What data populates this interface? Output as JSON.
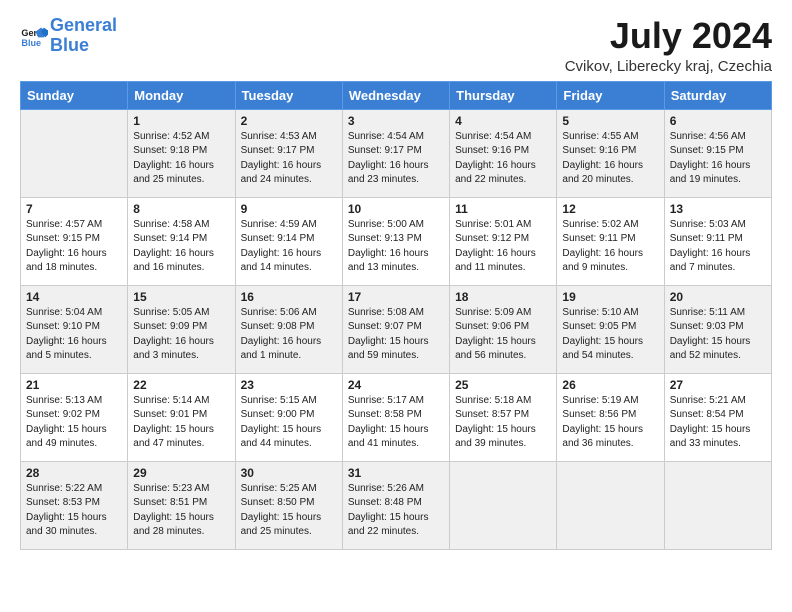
{
  "header": {
    "logo_line1": "General",
    "logo_line2": "Blue",
    "title": "July 2024",
    "subtitle": "Cvikov, Liberecky kraj, Czechia"
  },
  "days_of_week": [
    "Sunday",
    "Monday",
    "Tuesday",
    "Wednesday",
    "Thursday",
    "Friday",
    "Saturday"
  ],
  "weeks": [
    [
      {
        "day": "",
        "sunrise": "",
        "sunset": "",
        "daylight": ""
      },
      {
        "day": "1",
        "sunrise": "Sunrise: 4:52 AM",
        "sunset": "Sunset: 9:18 PM",
        "daylight": "Daylight: 16 hours and 25 minutes."
      },
      {
        "day": "2",
        "sunrise": "Sunrise: 4:53 AM",
        "sunset": "Sunset: 9:17 PM",
        "daylight": "Daylight: 16 hours and 24 minutes."
      },
      {
        "day": "3",
        "sunrise": "Sunrise: 4:54 AM",
        "sunset": "Sunset: 9:17 PM",
        "daylight": "Daylight: 16 hours and 23 minutes."
      },
      {
        "day": "4",
        "sunrise": "Sunrise: 4:54 AM",
        "sunset": "Sunset: 9:16 PM",
        "daylight": "Daylight: 16 hours and 22 minutes."
      },
      {
        "day": "5",
        "sunrise": "Sunrise: 4:55 AM",
        "sunset": "Sunset: 9:16 PM",
        "daylight": "Daylight: 16 hours and 20 minutes."
      },
      {
        "day": "6",
        "sunrise": "Sunrise: 4:56 AM",
        "sunset": "Sunset: 9:15 PM",
        "daylight": "Daylight: 16 hours and 19 minutes."
      }
    ],
    [
      {
        "day": "7",
        "sunrise": "Sunrise: 4:57 AM",
        "sunset": "Sunset: 9:15 PM",
        "daylight": "Daylight: 16 hours and 18 minutes."
      },
      {
        "day": "8",
        "sunrise": "Sunrise: 4:58 AM",
        "sunset": "Sunset: 9:14 PM",
        "daylight": "Daylight: 16 hours and 16 minutes."
      },
      {
        "day": "9",
        "sunrise": "Sunrise: 4:59 AM",
        "sunset": "Sunset: 9:14 PM",
        "daylight": "Daylight: 16 hours and 14 minutes."
      },
      {
        "day": "10",
        "sunrise": "Sunrise: 5:00 AM",
        "sunset": "Sunset: 9:13 PM",
        "daylight": "Daylight: 16 hours and 13 minutes."
      },
      {
        "day": "11",
        "sunrise": "Sunrise: 5:01 AM",
        "sunset": "Sunset: 9:12 PM",
        "daylight": "Daylight: 16 hours and 11 minutes."
      },
      {
        "day": "12",
        "sunrise": "Sunrise: 5:02 AM",
        "sunset": "Sunset: 9:11 PM",
        "daylight": "Daylight: 16 hours and 9 minutes."
      },
      {
        "day": "13",
        "sunrise": "Sunrise: 5:03 AM",
        "sunset": "Sunset: 9:11 PM",
        "daylight": "Daylight: 16 hours and 7 minutes."
      }
    ],
    [
      {
        "day": "14",
        "sunrise": "Sunrise: 5:04 AM",
        "sunset": "Sunset: 9:10 PM",
        "daylight": "Daylight: 16 hours and 5 minutes."
      },
      {
        "day": "15",
        "sunrise": "Sunrise: 5:05 AM",
        "sunset": "Sunset: 9:09 PM",
        "daylight": "Daylight: 16 hours and 3 minutes."
      },
      {
        "day": "16",
        "sunrise": "Sunrise: 5:06 AM",
        "sunset": "Sunset: 9:08 PM",
        "daylight": "Daylight: 16 hours and 1 minute."
      },
      {
        "day": "17",
        "sunrise": "Sunrise: 5:08 AM",
        "sunset": "Sunset: 9:07 PM",
        "daylight": "Daylight: 15 hours and 59 minutes."
      },
      {
        "day": "18",
        "sunrise": "Sunrise: 5:09 AM",
        "sunset": "Sunset: 9:06 PM",
        "daylight": "Daylight: 15 hours and 56 minutes."
      },
      {
        "day": "19",
        "sunrise": "Sunrise: 5:10 AM",
        "sunset": "Sunset: 9:05 PM",
        "daylight": "Daylight: 15 hours and 54 minutes."
      },
      {
        "day": "20",
        "sunrise": "Sunrise: 5:11 AM",
        "sunset": "Sunset: 9:03 PM",
        "daylight": "Daylight: 15 hours and 52 minutes."
      }
    ],
    [
      {
        "day": "21",
        "sunrise": "Sunrise: 5:13 AM",
        "sunset": "Sunset: 9:02 PM",
        "daylight": "Daylight: 15 hours and 49 minutes."
      },
      {
        "day": "22",
        "sunrise": "Sunrise: 5:14 AM",
        "sunset": "Sunset: 9:01 PM",
        "daylight": "Daylight: 15 hours and 47 minutes."
      },
      {
        "day": "23",
        "sunrise": "Sunrise: 5:15 AM",
        "sunset": "Sunset: 9:00 PM",
        "daylight": "Daylight: 15 hours and 44 minutes."
      },
      {
        "day": "24",
        "sunrise": "Sunrise: 5:17 AM",
        "sunset": "Sunset: 8:58 PM",
        "daylight": "Daylight: 15 hours and 41 minutes."
      },
      {
        "day": "25",
        "sunrise": "Sunrise: 5:18 AM",
        "sunset": "Sunset: 8:57 PM",
        "daylight": "Daylight: 15 hours and 39 minutes."
      },
      {
        "day": "26",
        "sunrise": "Sunrise: 5:19 AM",
        "sunset": "Sunset: 8:56 PM",
        "daylight": "Daylight: 15 hours and 36 minutes."
      },
      {
        "day": "27",
        "sunrise": "Sunrise: 5:21 AM",
        "sunset": "Sunset: 8:54 PM",
        "daylight": "Daylight: 15 hours and 33 minutes."
      }
    ],
    [
      {
        "day": "28",
        "sunrise": "Sunrise: 5:22 AM",
        "sunset": "Sunset: 8:53 PM",
        "daylight": "Daylight: 15 hours and 30 minutes."
      },
      {
        "day": "29",
        "sunrise": "Sunrise: 5:23 AM",
        "sunset": "Sunset: 8:51 PM",
        "daylight": "Daylight: 15 hours and 28 minutes."
      },
      {
        "day": "30",
        "sunrise": "Sunrise: 5:25 AM",
        "sunset": "Sunset: 8:50 PM",
        "daylight": "Daylight: 15 hours and 25 minutes."
      },
      {
        "day": "31",
        "sunrise": "Sunrise: 5:26 AM",
        "sunset": "Sunset: 8:48 PM",
        "daylight": "Daylight: 15 hours and 22 minutes."
      },
      {
        "day": "",
        "sunrise": "",
        "sunset": "",
        "daylight": ""
      },
      {
        "day": "",
        "sunrise": "",
        "sunset": "",
        "daylight": ""
      },
      {
        "day": "",
        "sunrise": "",
        "sunset": "",
        "daylight": ""
      }
    ]
  ]
}
